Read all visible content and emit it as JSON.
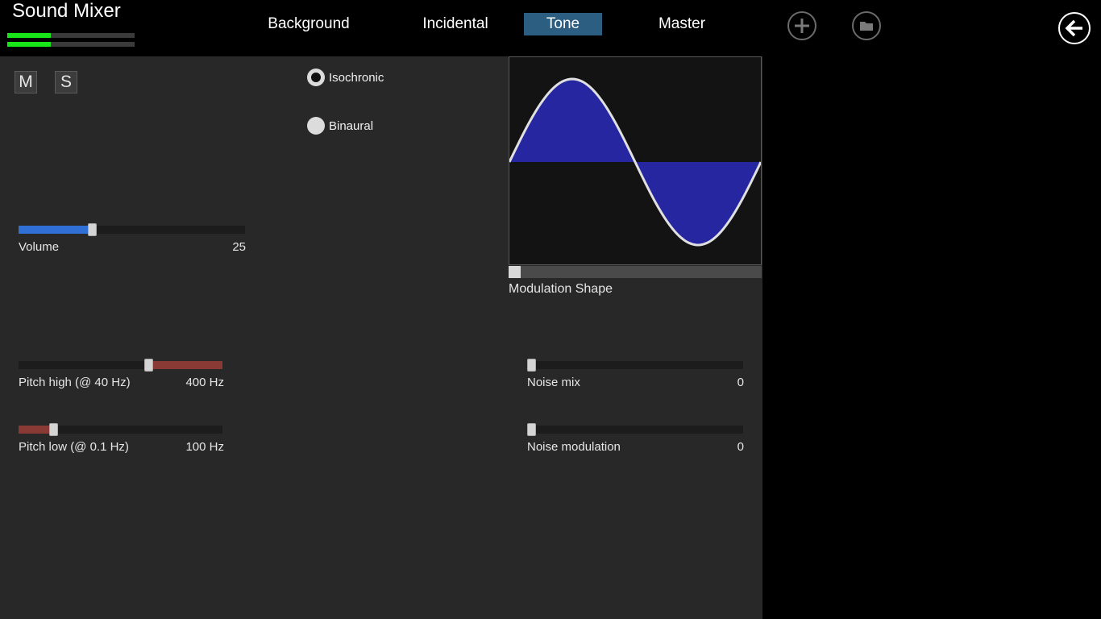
{
  "app": {
    "title": "Sound Mixer",
    "level_meters": [
      {
        "name": "left-channel",
        "level": 0.34
      },
      {
        "name": "right-channel",
        "level": 0.34
      }
    ],
    "meter_color": "#19e619"
  },
  "tabs": [
    {
      "label": "Background",
      "active": false
    },
    {
      "label": "Incidental",
      "active": false
    },
    {
      "label": "Tone",
      "active": true
    },
    {
      "label": "Master",
      "active": false
    }
  ],
  "header_icons": {
    "add": "plus-icon",
    "open": "folder-icon",
    "back": "back-arrow-icon"
  },
  "panel": {
    "mute_label": "M",
    "solo_label": "S",
    "mode": {
      "options": [
        "Isochronic",
        "Binaural"
      ],
      "selected": "Isochronic"
    },
    "volume": {
      "label": "Volume",
      "value": "25",
      "fraction": 0.32,
      "color": "#2f6fd6"
    },
    "pitch_high": {
      "label": "Pitch high (@ 40 Hz)",
      "value": "400 Hz",
      "fraction": 0.645,
      "color": "#8a3a34"
    },
    "pitch_low": {
      "label": "Pitch low (@ 0.1 Hz)",
      "value": "100 Hz",
      "fraction": 0.155,
      "color": "#8a3a34"
    },
    "modulation_shape": {
      "label": "Modulation Shape",
      "fraction": 0.0,
      "waveform": "sine",
      "fill_color": "#2626a0",
      "line_color": "#e0e0e0"
    },
    "noise_mix": {
      "label": "Noise mix",
      "value": "0",
      "fraction": 0.0
    },
    "noise_modulation": {
      "label": "Noise modulation",
      "value": "0",
      "fraction": 0.0
    }
  }
}
